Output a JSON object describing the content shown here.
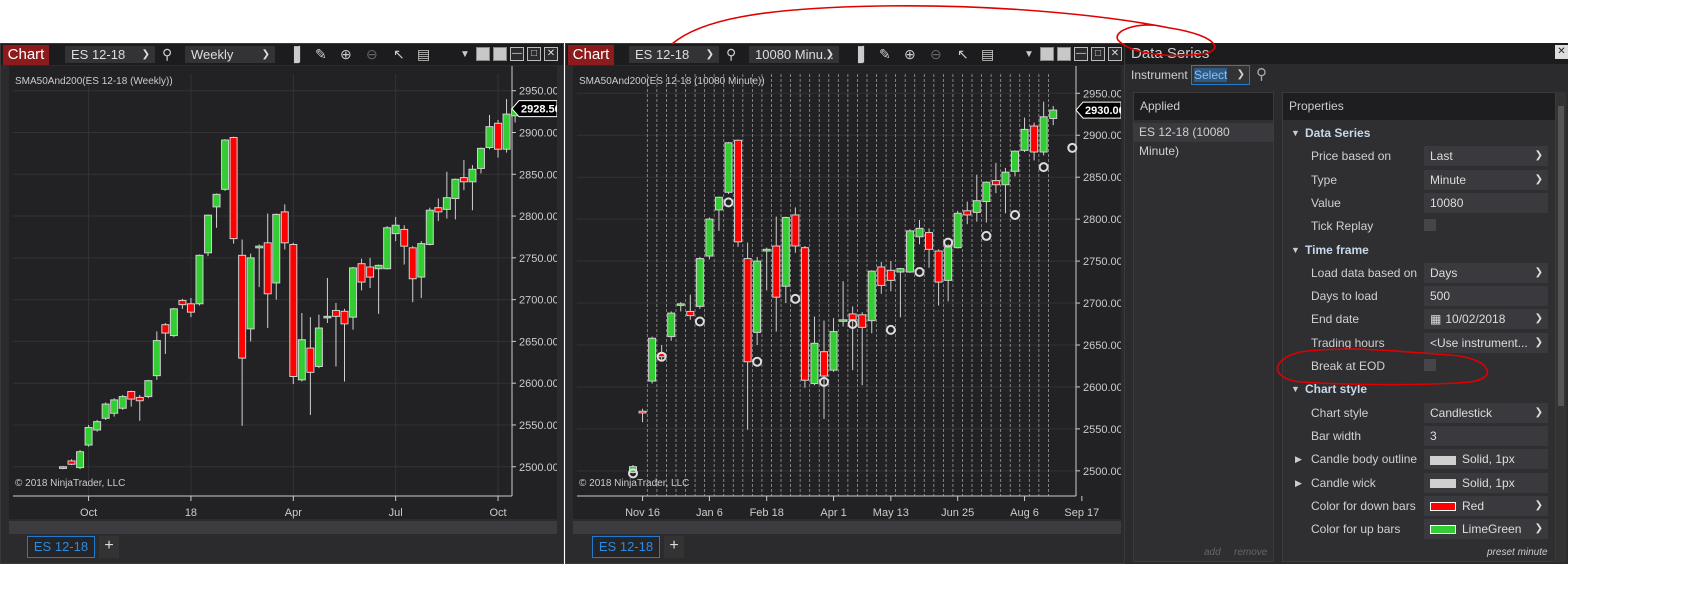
{
  "colors": {
    "up": "#32cd32",
    "down": "#ff0000",
    "chart_bg": "#222224",
    "accent": "#1e7bd0",
    "annotation": "#e00000",
    "chart_button": "#8e1b1b"
  },
  "left_chart": {
    "button": "Chart",
    "instrument": "ES 12-18",
    "interval": "Weekly",
    "indicator_label": "SMA50And200(ES 12-18 (Weekly))",
    "copyright": "© 2018 NinjaTrader, LLC",
    "tab": "ES 12-18",
    "tab_add": "+"
  },
  "right_chart": {
    "button": "Chart",
    "instrument": "ES 12-18",
    "interval": "10080 Minu...",
    "indicator_label": "SMA50And200(ES 12-18 (10080 Minute))",
    "copyright": "© 2018 NinjaTrader, LLC",
    "tab": "ES 12-18",
    "tab_add": "+"
  },
  "toolbar_icons": [
    "bar-type-icon",
    "drawing-pencil-icon",
    "zoom-in-icon",
    "zoom-out-icon",
    "pointer-icon",
    "properties-icon",
    "dropdown-arrow-icon",
    "minimize-icon",
    "maximize-icon",
    "close-icon"
  ],
  "data_series": {
    "title": "Data Series",
    "instrument_label": "Instrument",
    "instrument_value": "Select",
    "applied_header": "Applied",
    "applied_items": [
      "ES 12-18 (10080 Minute)"
    ],
    "add": "add",
    "remove": "remove",
    "properties_header": "Properties",
    "preset": "preset minute",
    "rows": [
      {
        "type": "section",
        "label": "Data Series"
      },
      {
        "type": "select",
        "label": "Price based on",
        "value": "Last"
      },
      {
        "type": "select",
        "label": "Type",
        "value": "Minute"
      },
      {
        "type": "text",
        "label": "Value",
        "value": "10080"
      },
      {
        "type": "check",
        "label": "Tick Replay",
        "value": false
      },
      {
        "type": "section",
        "label": "Time frame"
      },
      {
        "type": "select",
        "label": "Load data based on",
        "value": "Days"
      },
      {
        "type": "text",
        "label": "Days to load",
        "value": "500"
      },
      {
        "type": "date",
        "label": "End date",
        "value": "10/02/2018"
      },
      {
        "type": "select",
        "label": "Trading hours",
        "value": "<Use instrument..."
      },
      {
        "type": "check",
        "label": "Break at EOD",
        "value": false
      },
      {
        "type": "section",
        "label": "Chart style"
      },
      {
        "type": "select",
        "label": "Chart style",
        "value": "Candlestick"
      },
      {
        "type": "text",
        "label": "Bar width",
        "value": "3"
      },
      {
        "type": "stroke",
        "label": "Candle body outline",
        "value": "Solid, 1px",
        "swatch": "#d0d0d0"
      },
      {
        "type": "stroke",
        "label": "Candle wick",
        "value": "Solid, 1px",
        "swatch": "#d0d0d0"
      },
      {
        "type": "color",
        "label": "Color for down bars",
        "value": "Red",
        "swatch": "#ff0000"
      },
      {
        "type": "color",
        "label": "Color for up bars",
        "value": "LimeGreen",
        "swatch": "#32cd32"
      }
    ]
  },
  "chart_data": [
    {
      "type": "candlestick",
      "ylim": [
        2465,
        2970
      ],
      "last_price": "2928.50",
      "y_ticks": [
        "2500.00",
        "2550.00",
        "2600.00",
        "2650.00",
        "2700.00",
        "2750.00",
        "2800.00",
        "2850.00",
        "2900.00",
        "2950.00"
      ],
      "x_ticks": [
        {
          "label": "Oct",
          "index": 3
        },
        {
          "label": "18",
          "index": 15
        },
        {
          "label": "Apr",
          "index": 27
        },
        {
          "label": "Jul",
          "index": 39
        },
        {
          "label": "Oct",
          "index": 51
        }
      ],
      "ohlc": [
        [
          2498,
          2501,
          2497,
          2500
        ],
        [
          2507,
          2509,
          2502,
          2503
        ],
        [
          2499,
          2520,
          2497,
          2518
        ],
        [
          2526,
          2550,
          2524,
          2547
        ],
        [
          2544,
          2556,
          2542,
          2554
        ],
        [
          2558,
          2577,
          2556,
          2575
        ],
        [
          2564,
          2582,
          2560,
          2580
        ],
        [
          2570,
          2586,
          2568,
          2584
        ],
        [
          2590,
          2591,
          2572,
          2581
        ],
        [
          2583,
          2586,
          2555,
          2579
        ],
        [
          2584,
          2604,
          2582,
          2603
        ],
        [
          2609,
          2662,
          2604,
          2651
        ],
        [
          2670,
          2672,
          2635,
          2660
        ],
        [
          2657,
          2690,
          2655,
          2689
        ],
        [
          2699,
          2701,
          2689,
          2694
        ],
        [
          2695,
          2702,
          2679,
          2685
        ],
        [
          2695,
          2754,
          2693,
          2753
        ],
        [
          2756,
          2802,
          2752,
          2801
        ],
        [
          2811,
          2827,
          2786,
          2826
        ],
        [
          2832,
          2892,
          2830,
          2891
        ],
        [
          2894,
          2895,
          2767,
          2773
        ],
        [
          2753,
          2772,
          2549,
          2630
        ],
        [
          2665,
          2755,
          2650,
          2750
        ],
        [
          2762,
          2766,
          2715,
          2764
        ],
        [
          2768,
          2803,
          2666,
          2707
        ],
        [
          2720,
          2803,
          2700,
          2802
        ],
        [
          2805,
          2814,
          2760,
          2768
        ],
        [
          2766,
          2768,
          2599,
          2608
        ],
        [
          2604,
          2684,
          2602,
          2652
        ],
        [
          2642,
          2679,
          2562,
          2613
        ],
        [
          2620,
          2682,
          2618,
          2666
        ],
        [
          2680,
          2726,
          2672,
          2680
        ],
        [
          2687,
          2696,
          2620,
          2680
        ],
        [
          2686,
          2689,
          2602,
          2671
        ],
        [
          2679,
          2739,
          2664,
          2738
        ],
        [
          2743,
          2749,
          2711,
          2721
        ],
        [
          2739,
          2750,
          2714,
          2727
        ],
        [
          2737,
          2742,
          2683,
          2741
        ],
        [
          2737,
          2788,
          2736,
          2786
        ],
        [
          2779,
          2799,
          2770,
          2789
        ],
        [
          2784,
          2789,
          2742,
          2764
        ],
        [
          2762,
          2764,
          2697,
          2725
        ],
        [
          2727,
          2770,
          2702,
          2767
        ],
        [
          2766,
          2810,
          2765,
          2807
        ],
        [
          2810,
          2821,
          2794,
          2805
        ],
        [
          2808,
          2853,
          2797,
          2822
        ],
        [
          2821,
          2845,
          2796,
          2844
        ],
        [
          2846,
          2867,
          2831,
          2841
        ],
        [
          2841,
          2861,
          2807,
          2856
        ],
        [
          2857,
          2882,
          2851,
          2881
        ],
        [
          2882,
          2921,
          2880,
          2907
        ],
        [
          2911,
          2915,
          2870,
          2880
        ],
        [
          2880,
          2940,
          2876,
          2922
        ],
        [
          2920,
          2932,
          2912,
          2928.5
        ]
      ]
    },
    {
      "type": "candlestick",
      "ylim": [
        2470,
        2973
      ],
      "last_price": "2930.00",
      "session_breaks": true,
      "y_ticks": [
        "2500.00",
        "2550.00",
        "2600.00",
        "2650.00",
        "2700.00",
        "2750.00",
        "2800.00",
        "2850.00",
        "2900.00",
        "2950.00"
      ],
      "x_ticks": [
        {
          "label": "Nov 16",
          "index": 1
        },
        {
          "label": "Jan 6",
          "index": 8
        },
        {
          "label": "Feb 18",
          "index": 14
        },
        {
          "label": "Apr 1",
          "index": 21
        },
        {
          "label": "May 13",
          "index": 27
        },
        {
          "label": "Jun 25",
          "index": 34
        },
        {
          "label": "Aug 6",
          "index": 41
        },
        {
          "label": "Sep 17",
          "index": 47
        }
      ],
      "markers": [
        [
          0,
          2497
        ],
        [
          3,
          2636
        ],
        [
          7,
          2678
        ],
        [
          10,
          2820
        ],
        [
          13,
          2630
        ],
        [
          17,
          2705
        ],
        [
          20,
          2606
        ],
        [
          23,
          2675
        ],
        [
          27,
          2668
        ],
        [
          30,
          2737
        ],
        [
          33,
          2772
        ],
        [
          37,
          2780
        ],
        [
          40,
          2805
        ],
        [
          43,
          2862
        ],
        [
          46,
          2885
        ],
        [
          50,
          2930
        ]
      ],
      "ohlc": [
        [
          2498,
          2507,
          2497,
          2505
        ],
        [
          2571,
          2574,
          2558,
          2569
        ],
        [
          2607,
          2660,
          2604,
          2658
        ],
        [
          2640,
          2650,
          2632,
          2636
        ],
        [
          2660,
          2690,
          2655,
          2688
        ],
        [
          2699,
          2701,
          2690,
          2699
        ],
        [
          2690,
          2710,
          2680,
          2685
        ],
        [
          2696,
          2755,
          2693,
          2753
        ],
        [
          2756,
          2802,
          2752,
          2800
        ],
        [
          2811,
          2827,
          2786,
          2826
        ],
        [
          2832,
          2892,
          2830,
          2891
        ],
        [
          2894,
          2895,
          2767,
          2773
        ],
        [
          2753,
          2772,
          2549,
          2630
        ],
        [
          2665,
          2755,
          2650,
          2750
        ],
        [
          2762,
          2766,
          2715,
          2764
        ],
        [
          2768,
          2803,
          2666,
          2707
        ],
        [
          2720,
          2803,
          2700,
          2802
        ],
        [
          2805,
          2814,
          2760,
          2768
        ],
        [
          2766,
          2768,
          2599,
          2608
        ],
        [
          2604,
          2684,
          2602,
          2652
        ],
        [
          2642,
          2679,
          2562,
          2613
        ],
        [
          2620,
          2682,
          2618,
          2666
        ],
        [
          2680,
          2726,
          2672,
          2680
        ],
        [
          2687,
          2696,
          2620,
          2680
        ],
        [
          2686,
          2689,
          2602,
          2671
        ],
        [
          2679,
          2739,
          2664,
          2738
        ],
        [
          2743,
          2749,
          2711,
          2721
        ],
        [
          2739,
          2750,
          2714,
          2727
        ],
        [
          2737,
          2742,
          2683,
          2741
        ],
        [
          2737,
          2788,
          2736,
          2786
        ],
        [
          2779,
          2799,
          2770,
          2789
        ],
        [
          2784,
          2789,
          2742,
          2764
        ],
        [
          2762,
          2764,
          2697,
          2725
        ],
        [
          2727,
          2770,
          2702,
          2767
        ],
        [
          2766,
          2810,
          2765,
          2807
        ],
        [
          2810,
          2821,
          2794,
          2805
        ],
        [
          2808,
          2853,
          2797,
          2822
        ],
        [
          2821,
          2845,
          2796,
          2844
        ],
        [
          2846,
          2867,
          2831,
          2841
        ],
        [
          2841,
          2861,
          2807,
          2856
        ],
        [
          2857,
          2882,
          2851,
          2881
        ],
        [
          2882,
          2921,
          2880,
          2907
        ],
        [
          2911,
          2915,
          2870,
          2880
        ],
        [
          2880,
          2940,
          2876,
          2922
        ],
        [
          2920,
          2935,
          2912,
          2930
        ]
      ]
    }
  ]
}
